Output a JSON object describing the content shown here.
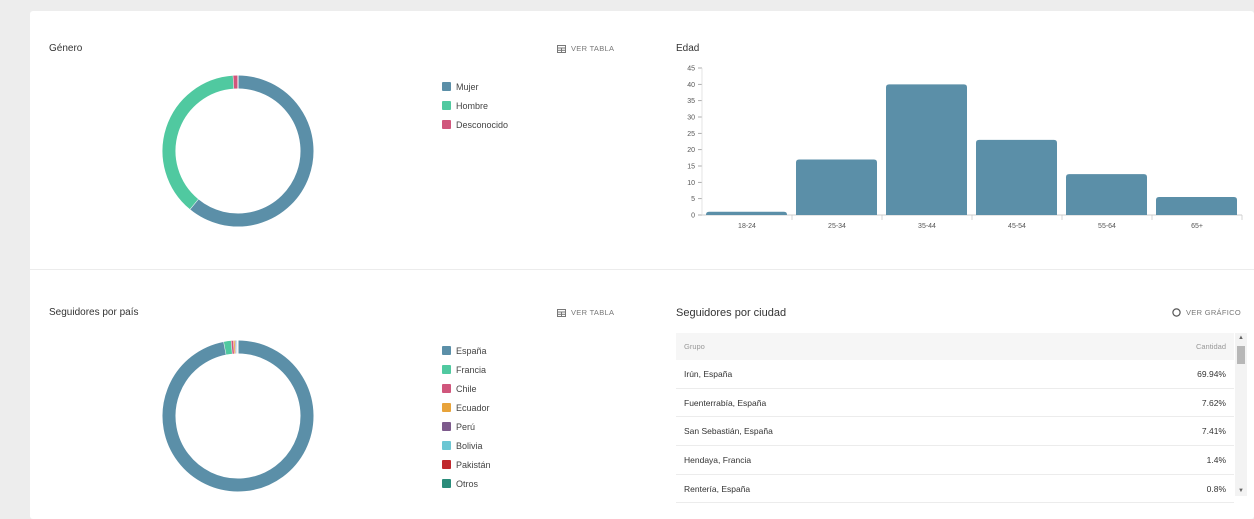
{
  "gender": {
    "title": "Género",
    "ver_tabla": "VER TABLA",
    "legend": [
      {
        "label": "Mujer",
        "color": "#5b8fa8",
        "value": 61
      },
      {
        "label": "Hombre",
        "color": "#50c9a0",
        "value": 38
      },
      {
        "label": "Desconocido",
        "color": "#d0567c",
        "value": 1
      }
    ]
  },
  "age": {
    "title": "Edad"
  },
  "chart_data": {
    "type": "bar",
    "categories": [
      "18-24",
      "25-34",
      "35-44",
      "45-54",
      "55-64",
      "65+"
    ],
    "values": [
      1,
      17,
      40,
      23,
      12.5,
      5.5
    ],
    "ylim": [
      0,
      45
    ],
    "yticks": [
      0,
      5,
      10,
      15,
      20,
      25,
      30,
      35,
      40,
      45
    ],
    "color": "#5b8fa8",
    "xlabel": "",
    "ylabel": ""
  },
  "country": {
    "title": "Seguidores por país",
    "ver_tabla": "VER TABLA",
    "legend": [
      {
        "label": "España",
        "color": "#5b8fa8",
        "value": 97
      },
      {
        "label": "Francia",
        "color": "#50c9a0",
        "value": 1.6
      },
      {
        "label": "Chile",
        "color": "#d0567c",
        "value": 0.5
      },
      {
        "label": "Ecuador",
        "color": "#e8a33a",
        "value": 0.3
      },
      {
        "label": "Perú",
        "color": "#7d5a8c",
        "value": 0.2
      },
      {
        "label": "Bolivia",
        "color": "#6cc6d3",
        "value": 0.2
      },
      {
        "label": "Pakistán",
        "color": "#c0282d",
        "value": 0.1
      },
      {
        "label": "Otros",
        "color": "#2a8c7a",
        "value": 0.1
      }
    ]
  },
  "city": {
    "title": "Seguidores por ciudad",
    "ver_grafico": "VER GRÁFICO",
    "columns": [
      "Grupo",
      "Cantidad"
    ],
    "rows": [
      {
        "group": "Irún, España",
        "amount": "69.94%"
      },
      {
        "group": "Fuenterrabía, España",
        "amount": "7.62%"
      },
      {
        "group": "San Sebastián, España",
        "amount": "7.41%"
      },
      {
        "group": "Hendaya, Francia",
        "amount": "1.4%"
      },
      {
        "group": "Rentería, España",
        "amount": "0.8%"
      }
    ]
  }
}
